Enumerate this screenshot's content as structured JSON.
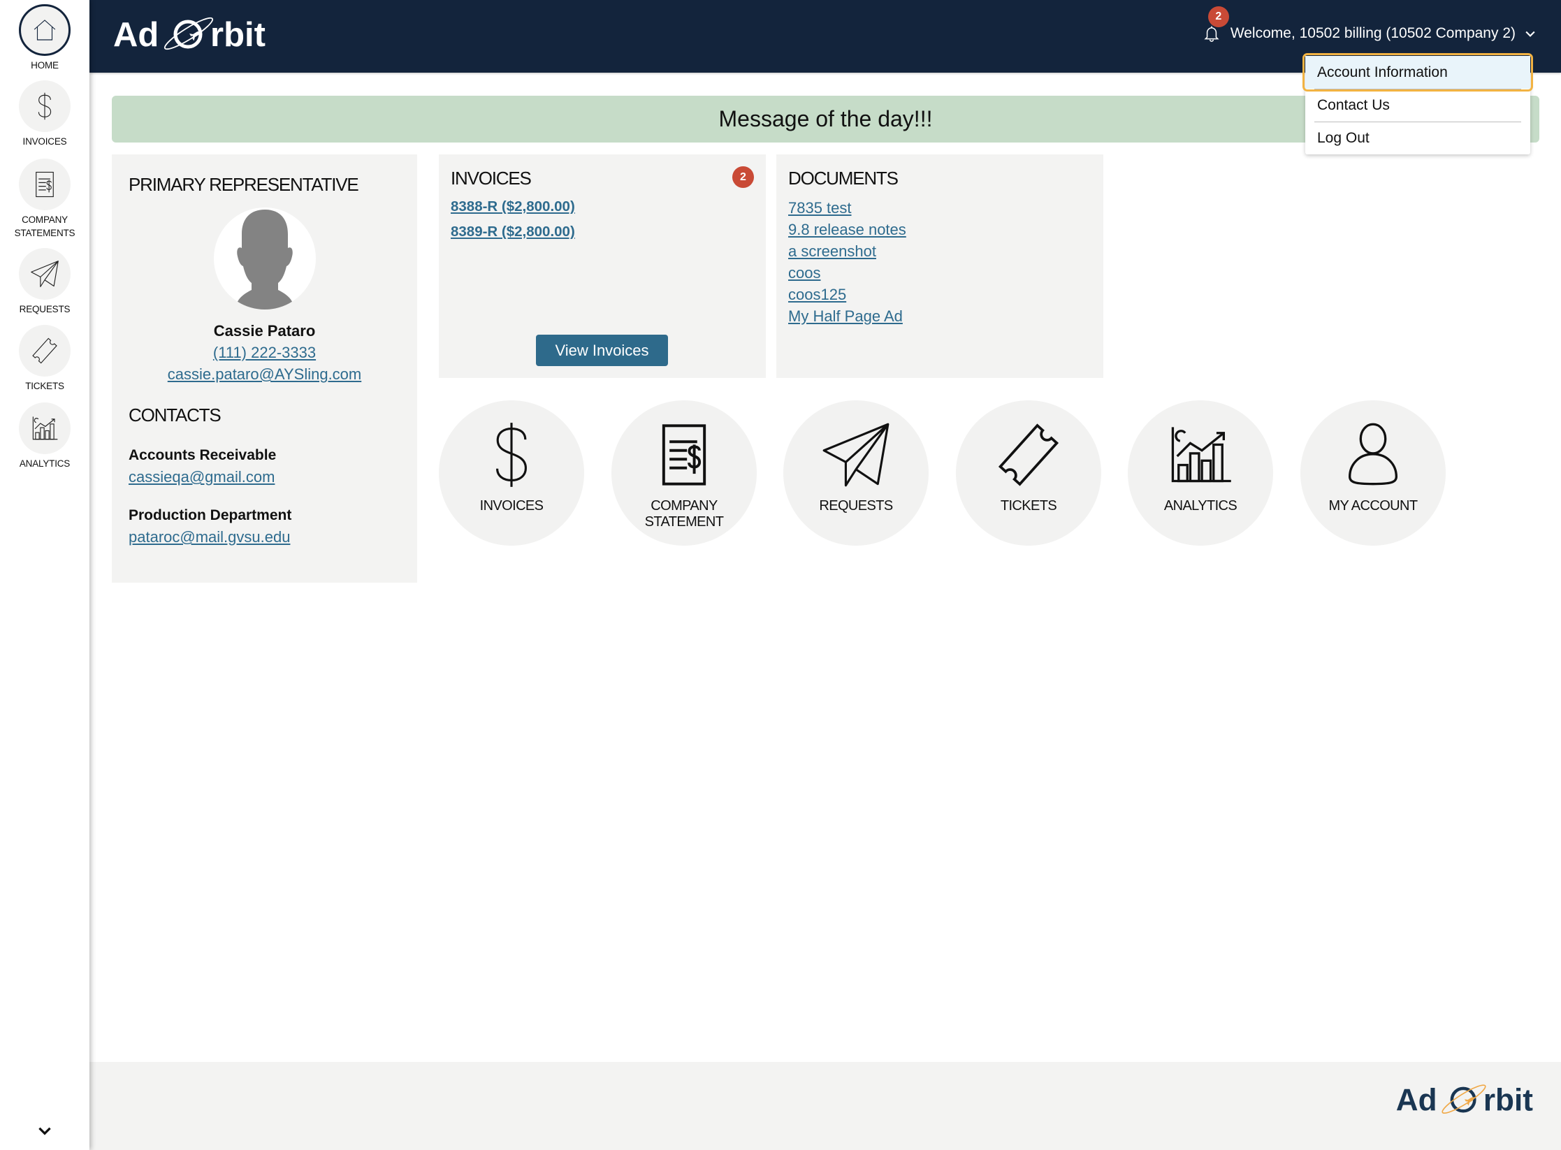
{
  "header": {
    "logo": {
      "text_left": "Ad",
      "text_right": "rbit",
      "icon": "orbit-logo-icon"
    },
    "notification_count": "2",
    "welcome_text": "Welcome, 10502 billing (10502 Company 2)"
  },
  "user_menu": {
    "items": [
      {
        "label": "Account Information",
        "focused": true
      },
      {
        "label": "Contact Us"
      },
      {
        "label": "Log Out"
      }
    ]
  },
  "sidebar": {
    "items": [
      {
        "label": "HOME",
        "icon": "home-icon",
        "active": true
      },
      {
        "label": "INVOICES",
        "icon": "dollar-icon"
      },
      {
        "label": "COMPANY STATEMENTS",
        "icon": "statement-icon"
      },
      {
        "label": "REQUESTS",
        "icon": "paper-plane-icon"
      },
      {
        "label": "TICKETS",
        "icon": "ticket-icon"
      },
      {
        "label": "ANALYTICS",
        "icon": "analytics-icon"
      }
    ],
    "collapse_icon": "chevron-down-icon"
  },
  "banner": {
    "message": "Message of the day!!!"
  },
  "primary_representative": {
    "title": "PRIMARY REPRESENTATIVE",
    "name": "Cassie Pataro",
    "phone": "(111) 222-3333",
    "email": "cassie.pataro@AYSling.com"
  },
  "contacts": {
    "title": "CONTACTS",
    "items": [
      {
        "department": "Accounts Receivable",
        "email": "cassieqa@gmail.com"
      },
      {
        "department": "Production Department",
        "email": "pataroc@mail.gvsu.edu"
      }
    ]
  },
  "invoices": {
    "title": "INVOICES",
    "badge_count": "2",
    "items": [
      "8388-R ($2,800.00)",
      "8389-R ($2,800.00)"
    ],
    "button_label": "View Invoices"
  },
  "documents": {
    "title": "DOCUMENTS",
    "items": [
      "7835 test",
      "9.8 release notes",
      "a screenshot",
      "coos",
      "coos125",
      "My Half Page Ad"
    ]
  },
  "quick_links": [
    {
      "label": "INVOICES",
      "icon": "dollar-icon"
    },
    {
      "label": "COMPANY STATEMENT",
      "icon": "statement-icon"
    },
    {
      "label": "REQUESTS",
      "icon": "paper-plane-icon"
    },
    {
      "label": "TICKETS",
      "icon": "ticket-icon"
    },
    {
      "label": "ANALYTICS",
      "icon": "analytics-icon"
    },
    {
      "label": "MY ACCOUNT",
      "icon": "user-icon"
    }
  ],
  "footer": {
    "logo": {
      "text_left": "Ad",
      "text_right": "rbit"
    }
  },
  "colors": {
    "header_bg": "#13243c",
    "link": "#2e6b8e",
    "badge": "#c94a36",
    "button": "#2e6a8b",
    "banner_bg": "#c6dcc8",
    "card_bg": "#f3f3f2",
    "focus_ring": "#f2b343",
    "logo_orbit_accent": "#f0a846"
  }
}
